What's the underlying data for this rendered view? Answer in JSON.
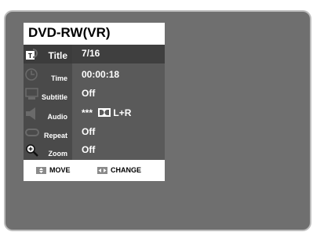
{
  "header": {
    "title": "DVD-RW(VR)"
  },
  "menu": {
    "rows": [
      {
        "label": "Title",
        "value": "7/16",
        "icon": "title-icon"
      },
      {
        "label": "Time",
        "value": "00:00:18",
        "icon": "clock-icon"
      },
      {
        "label": "Subtitle",
        "value": "Off",
        "icon": "subtitle-icon"
      },
      {
        "label": "Audio",
        "value": "***",
        "icon": "speaker-icon",
        "audio_channels": "L+R"
      },
      {
        "label": "Repeat",
        "value": "Off",
        "icon": "repeat-icon"
      },
      {
        "label": "Zoom",
        "value": "Off",
        "icon": "zoom-icon"
      }
    ],
    "selected_index": 0
  },
  "footer": {
    "move_label": "MOVE",
    "change_label": "CHANGE"
  },
  "colors": {
    "screen_bg": "#6f6f6f",
    "menu_label_bg": "#4a4a4a",
    "menu_value_bg": "#5a5a5a",
    "selected_bg": "#3c3c3c",
    "text": "#ffffff"
  }
}
